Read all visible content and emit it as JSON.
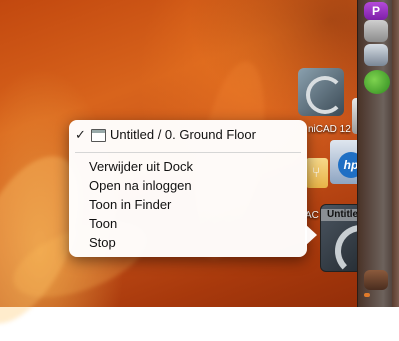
{
  "context_menu": {
    "window_title": "Untitled / 0. Ground Floor",
    "items": [
      {
        "label": "Verwijder uit Dock"
      },
      {
        "label": "Open na inloggen"
      },
      {
        "label": "Toon in Finder"
      },
      {
        "label": "Toon"
      },
      {
        "label": "Stop"
      }
    ]
  },
  "dock": {
    "partial_labels": {
      "app_name_fragment": "niCAD 12",
      "ac_fragment": "AC",
      "thumbnail_title": "Untitled"
    }
  }
}
